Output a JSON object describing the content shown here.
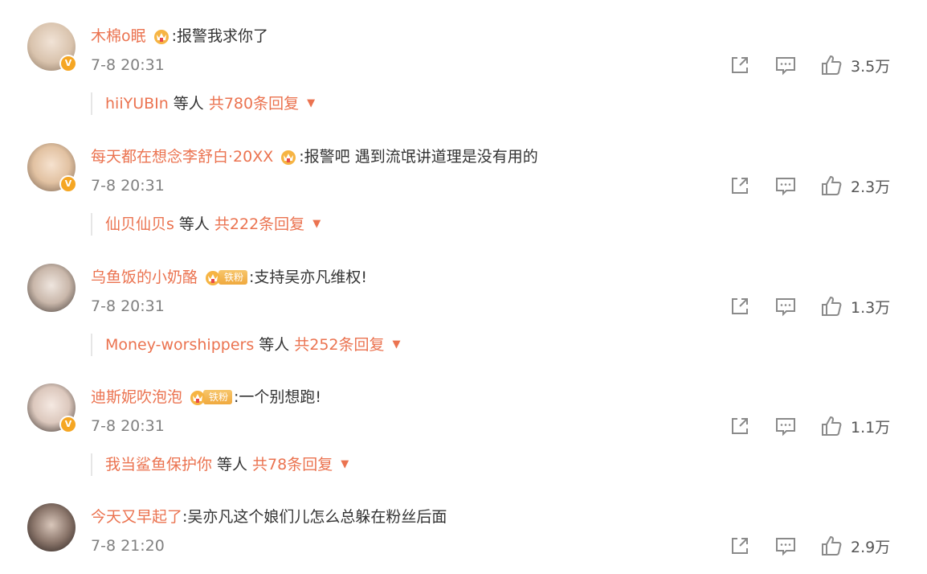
{
  "comments": [
    {
      "username": "木棉o眠",
      "has_crown": true,
      "fan_tag": "",
      "text": ":报警我求你了",
      "time": "7-8 20:31",
      "likes": "3.5万",
      "replies": {
        "user": "hiiYUBIn",
        "etc": "等人",
        "total": "共780条回复"
      }
    },
    {
      "username": "每天都在想念李舒白·20XX",
      "has_crown": true,
      "fan_tag": "",
      "text": ":报警吧 遇到流氓讲道理是没有用的",
      "time": "7-8 20:31",
      "likes": "2.3万",
      "replies": {
        "user": "仙贝仙贝s",
        "etc": "等人",
        "total": "共222条回复"
      }
    },
    {
      "username": "乌鱼饭的小奶酪",
      "has_crown": true,
      "fan_tag": "铁粉",
      "text": ":支持吴亦凡维权!",
      "time": "7-8 20:31",
      "likes": "1.3万",
      "replies": {
        "user": "Money-worshippers",
        "etc": "等人",
        "total": "共252条回复"
      }
    },
    {
      "username": "迪斯妮吹泡泡",
      "has_crown": true,
      "fan_tag": "铁粉",
      "text": ":一个别想跑!",
      "time": "7-8 20:31",
      "likes": "1.1万",
      "replies": {
        "user": "我当鲨鱼保护你",
        "etc": "等人",
        "total": "共78条回复"
      }
    },
    {
      "username": "今天又早起了",
      "has_crown": false,
      "fan_tag": "",
      "text": ":吴亦凡这个娘们儿怎么总躲在粉丝后面",
      "time": "7-8 21:20",
      "likes": "2.9万",
      "replies": null
    }
  ],
  "colors": {
    "accent": "#eb7350",
    "text": "#333333",
    "muted": "#808080",
    "verified": "#f5a623"
  },
  "icons": {
    "share": "share-icon",
    "reply": "comment-icon",
    "like": "thumbs-up-icon",
    "crown": "crown-badge-icon",
    "verified": "verified-v-icon",
    "caret": "caret-down-icon"
  }
}
